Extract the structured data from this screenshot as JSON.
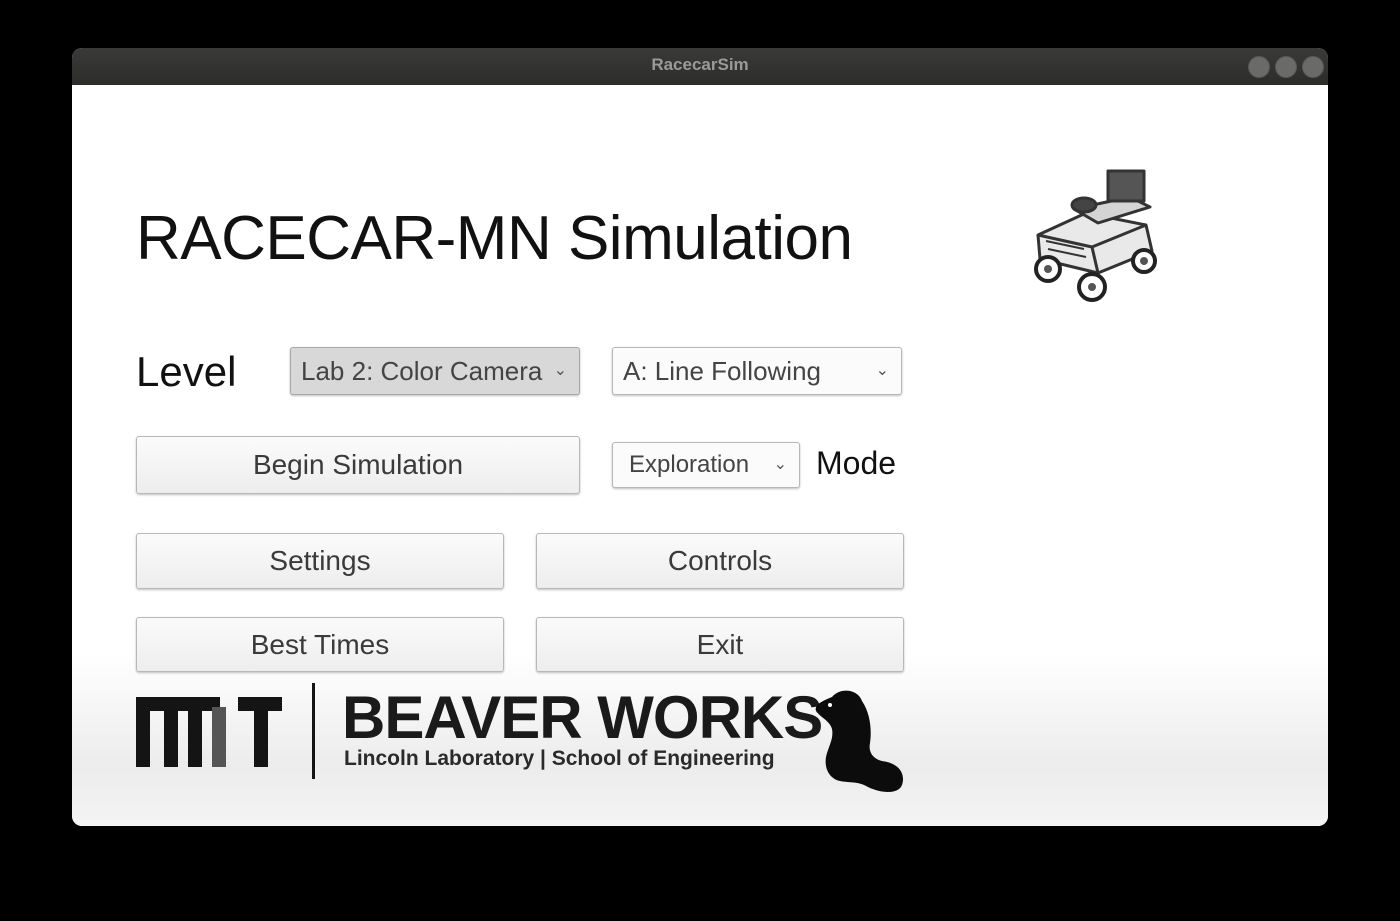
{
  "window": {
    "title": "RacecarSim",
    "controls": [
      "minimize-icon",
      "maximize-icon",
      "close-icon"
    ]
  },
  "main": {
    "heading": "RACECAR-MN Simulation",
    "level_label": "Level",
    "level_select": {
      "value": "Lab 2: Color Camera"
    },
    "sublevel_select": {
      "value": "A: Line Following"
    },
    "begin_button": "Begin Simulation",
    "mode_select": {
      "value": "Exploration"
    },
    "mode_label": "Mode",
    "settings_button": "Settings",
    "controls_button": "Controls",
    "best_times_button": "Best Times",
    "exit_button": "Exit"
  },
  "footer": {
    "org_title": "BEAVER WORKS",
    "org_subtitle": "Lincoln Laboratory  |  School of Engineering",
    "logo": "mit-logo",
    "mascot": "beaver-icon"
  },
  "icons": {
    "car": "racecar-icon",
    "chevron": "chevron-down-icon"
  }
}
